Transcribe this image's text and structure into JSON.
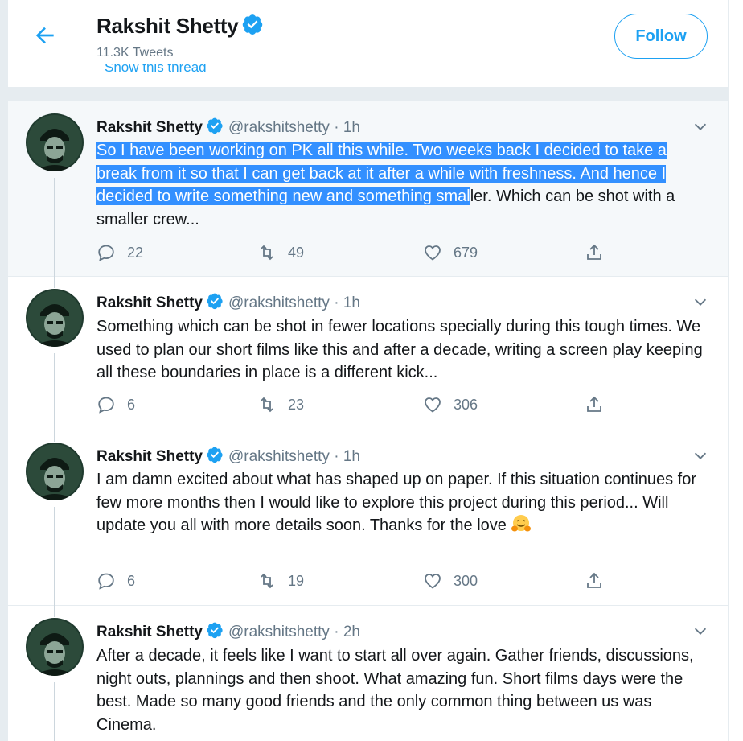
{
  "header": {
    "name": "Rakshit Shetty",
    "tweet_count": "11.3K Tweets",
    "follow_label": "Follow",
    "cutoff_text": "Show this thread"
  },
  "tweets": [
    {
      "name": "Rakshit Shetty",
      "handle": "@rakshitshetty",
      "time": "1h",
      "text_highlighted": "So I have been working on PK all this while. Two weeks back I decided to take a break from it so that I can get back at it after a while with freshness. And hence I decided to write something new and something smal",
      "text": "ler. Which can be shot with a smaller crew...",
      "replies": "22",
      "retweets": "49",
      "likes": "679"
    },
    {
      "name": "Rakshit Shetty",
      "handle": "@rakshitshetty",
      "time": "1h",
      "text": "Something which can be shot in fewer locations specially during this tough times. We used to plan our short films like this and after a decade, writing a screen play keeping all these boundaries in place is a different kick...",
      "replies": "6",
      "retweets": "23",
      "likes": "306"
    },
    {
      "name": "Rakshit Shetty",
      "handle": "@rakshitshetty",
      "time": "1h",
      "text": "I am damn excited about what has shaped up on paper. If this situation continues for few more months then I would like to explore this project during this period... Will update you all with more details soon. Thanks for the love",
      "replies": "6",
      "retweets": "19",
      "likes": "300"
    },
    {
      "name": "Rakshit Shetty",
      "handle": "@rakshitshetty",
      "time": "2h",
      "text": "After a decade, it feels like I want to start all over again. Gather friends, discussions, night outs, plannings  and then shoot. What amazing fun. Short films days were the best. Made so many good friends and the only common thing between us was Cinema."
    }
  ],
  "colors": {
    "accent": "#1da1f2",
    "secondary_text": "#657786",
    "selection": "#3390ff"
  }
}
